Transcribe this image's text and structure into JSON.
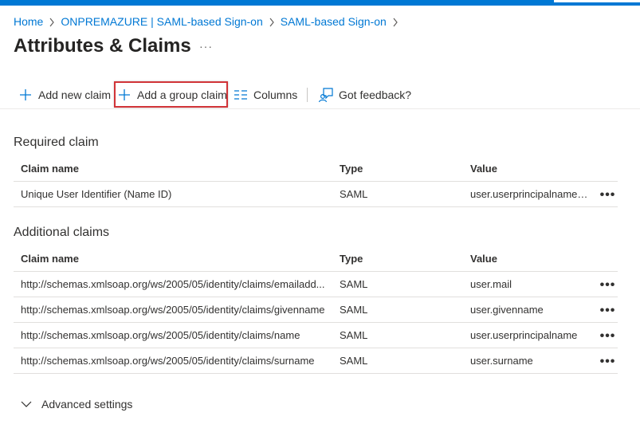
{
  "breadcrumb": [
    {
      "label": "Home"
    },
    {
      "label": "ONPREMAZURE | SAML-based Sign-on"
    },
    {
      "label": "SAML-based Sign-on"
    }
  ],
  "page": {
    "title": "Attributes & Claims",
    "more": "···"
  },
  "toolbar": {
    "add_new_claim": "Add new claim",
    "add_group_claim": "Add a group claim",
    "columns": "Columns",
    "feedback": "Got feedback?"
  },
  "required": {
    "title": "Required claim",
    "headers": {
      "name": "Claim name",
      "type": "Type",
      "value": "Value"
    },
    "rows": [
      {
        "name": "Unique User Identifier (Name ID)",
        "type": "SAML",
        "value": "user.userprincipalname [..."
      }
    ]
  },
  "additional": {
    "title": "Additional claims",
    "headers": {
      "name": "Claim name",
      "type": "Type",
      "value": "Value"
    },
    "rows": [
      {
        "name": "http://schemas.xmlsoap.org/ws/2005/05/identity/claims/emailadd...",
        "type": "SAML",
        "value": "user.mail"
      },
      {
        "name": "http://schemas.xmlsoap.org/ws/2005/05/identity/claims/givenname",
        "type": "SAML",
        "value": "user.givenname"
      },
      {
        "name": "http://schemas.xmlsoap.org/ws/2005/05/identity/claims/name",
        "type": "SAML",
        "value": "user.userprincipalname"
      },
      {
        "name": "http://schemas.xmlsoap.org/ws/2005/05/identity/claims/surname",
        "type": "SAML",
        "value": "user.surname"
      }
    ]
  },
  "advanced": {
    "label": "Advanced settings"
  },
  "row_more": "•••",
  "colors": {
    "accent": "#0078d4",
    "highlight": "#d13438",
    "text": "#323130",
    "border": "#e1dfdd"
  },
  "icons": [
    "chevron-right-icon",
    "plus-icon",
    "columns-icon",
    "feedback-icon",
    "more-icon",
    "chevron-down-icon"
  ]
}
